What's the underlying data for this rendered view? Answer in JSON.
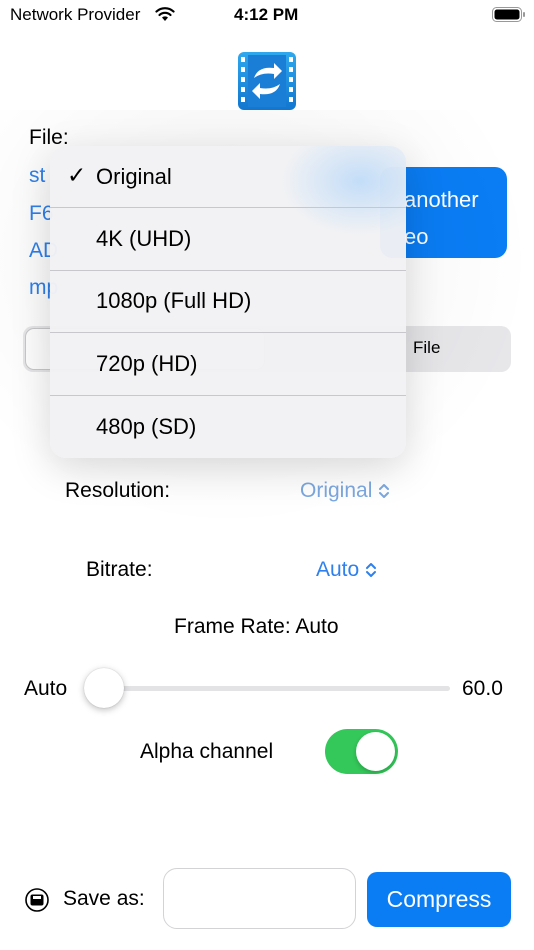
{
  "status_bar": {
    "carrier": "Network Provider",
    "time": "4:12 PM"
  },
  "file": {
    "label": "File:",
    "name_lines": [
      "st",
      "F6",
      "AD",
      "mp"
    ],
    "pick_another_label_line1": "another",
    "pick_another_label_line2": "eo"
  },
  "segmented": {
    "visible_label": "File"
  },
  "resolution": {
    "label": "Resolution:",
    "value": "Original"
  },
  "bitrate": {
    "label": "Bitrate:",
    "value": "Auto"
  },
  "frame_rate": {
    "label": "Frame Rate: Auto",
    "slider_min_label": "Auto",
    "slider_max_label": "60.0",
    "slider_level_fraction": 0.0
  },
  "alpha_channel": {
    "label": "Alpha channel",
    "enabled": true
  },
  "save": {
    "label": "Save as:",
    "input_value": "",
    "compress_label": "Compress"
  },
  "resolution_menu": {
    "items": [
      {
        "label": "Original",
        "checked": true
      },
      {
        "label": "4K (UHD)",
        "checked": false
      },
      {
        "label": "1080p (Full HD)",
        "checked": false
      },
      {
        "label": "720p (HD)",
        "checked": false
      },
      {
        "label": "480p (SD)",
        "checked": false
      }
    ],
    "check_mark": "✓"
  },
  "colors": {
    "accent": "#0a7df5",
    "link": "#2f80ed",
    "toggle_on": "#34c759"
  },
  "icons": [
    "wifi-icon",
    "battery-icon",
    "app-icon",
    "chevron-updown-icon",
    "save-disk-icon"
  ]
}
